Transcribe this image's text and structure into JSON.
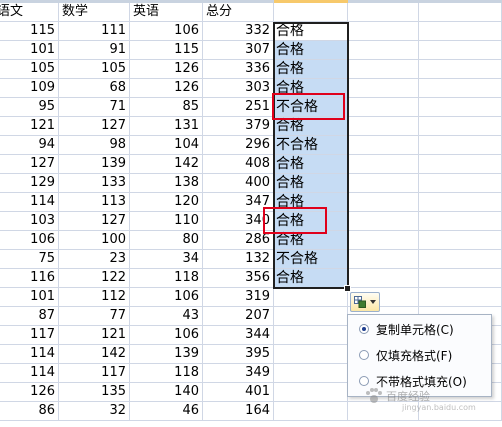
{
  "headers": [
    "语文",
    "数学",
    "英语",
    "总分"
  ],
  "rows": [
    {
      "chinese": "115",
      "math": "111",
      "english": "106",
      "total": "332",
      "result": "合格"
    },
    {
      "chinese": "101",
      "math": "91",
      "english": "115",
      "total": "307",
      "result": "合格"
    },
    {
      "chinese": "105",
      "math": "105",
      "english": "126",
      "total": "336",
      "result": "合格"
    },
    {
      "chinese": "109",
      "math": "68",
      "english": "126",
      "total": "303",
      "result": "合格"
    },
    {
      "chinese": "95",
      "math": "71",
      "english": "85",
      "total": "251",
      "result": "不合格"
    },
    {
      "chinese": "121",
      "math": "127",
      "english": "131",
      "total": "379",
      "result": "合格"
    },
    {
      "chinese": "94",
      "math": "98",
      "english": "104",
      "total": "296",
      "result": "不合格"
    },
    {
      "chinese": "127",
      "math": "139",
      "english": "142",
      "total": "408",
      "result": "合格"
    },
    {
      "chinese": "129",
      "math": "133",
      "english": "138",
      "total": "400",
      "result": "合格"
    },
    {
      "chinese": "114",
      "math": "113",
      "english": "120",
      "total": "347",
      "result": "合格"
    },
    {
      "chinese": "103",
      "math": "127",
      "english": "110",
      "total": "340",
      "result": "合格"
    },
    {
      "chinese": "106",
      "math": "100",
      "english": "80",
      "total": "286",
      "result": "合格"
    },
    {
      "chinese": "75",
      "math": "23",
      "english": "34",
      "total": "132",
      "result": "不合格"
    },
    {
      "chinese": "116",
      "math": "122",
      "english": "118",
      "total": "356",
      "result": "合格"
    },
    {
      "chinese": "101",
      "math": "112",
      "english": "106",
      "total": "319",
      "result": ""
    },
    {
      "chinese": "87",
      "math": "77",
      "english": "43",
      "total": "207",
      "result": ""
    },
    {
      "chinese": "117",
      "math": "121",
      "english": "106",
      "total": "344",
      "result": ""
    },
    {
      "chinese": "114",
      "math": "142",
      "english": "139",
      "total": "395",
      "result": ""
    },
    {
      "chinese": "114",
      "math": "117",
      "english": "118",
      "total": "349",
      "result": ""
    },
    {
      "chinese": "126",
      "math": "135",
      "english": "140",
      "total": "401",
      "result": ""
    },
    {
      "chinese": "86",
      "math": "32",
      "english": "46",
      "total": "164",
      "result": ""
    }
  ],
  "autofill_menu": {
    "items": [
      {
        "label": "复制单元格(C)",
        "selected": true
      },
      {
        "label": "仅填充格式(F)",
        "selected": false
      },
      {
        "label": "不带格式填充(O)",
        "selected": false
      }
    ]
  },
  "watermark": {
    "text": "百度经验",
    "url": "jingyan.baidu.com"
  },
  "colors": {
    "selection_fill": "#c6dcf4",
    "highlight_box": "#e0001a",
    "gridline": "#d0d7e5"
  }
}
